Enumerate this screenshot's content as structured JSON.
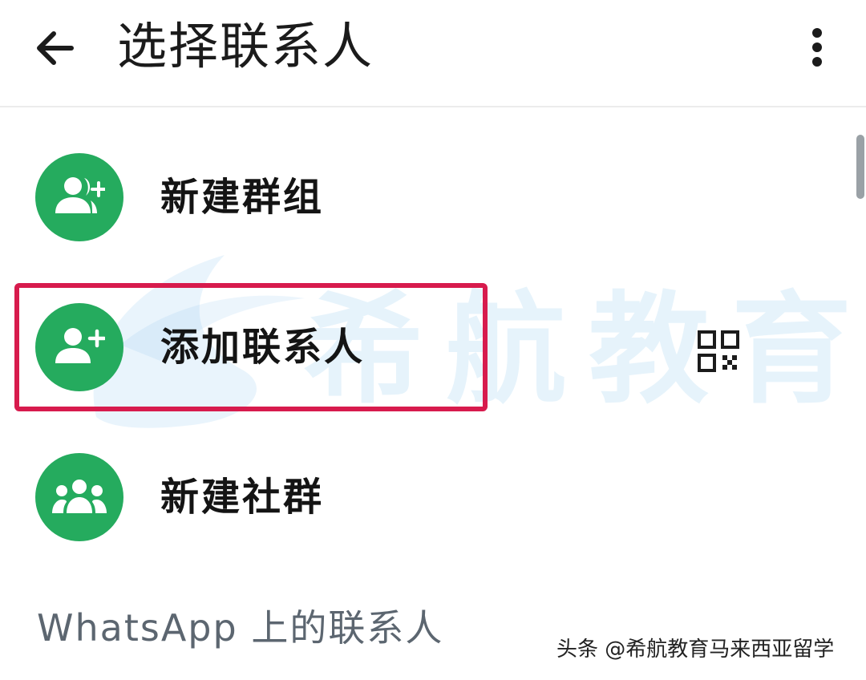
{
  "header": {
    "title": "选择联系人",
    "back_icon": "arrow-left-icon",
    "menu_icon": "more-vertical-icon"
  },
  "actions": [
    {
      "label": "新建群组",
      "icon": "group-add-icon"
    },
    {
      "label": "添加联系人",
      "icon": "person-add-icon",
      "trailing_icon": "qr-code-icon",
      "highlighted": true
    },
    {
      "label": "新建社群",
      "icon": "community-icon"
    }
  ],
  "section": {
    "title": "WhatsApp 上的联系人"
  },
  "watermark": {
    "text": "希航教育"
  },
  "credit": {
    "text": "头条 @希航教育马来西亚留学"
  },
  "colors": {
    "accent_green": "#25ab5e",
    "highlight_red": "#d71b4d",
    "watermark_blue": "#76baeb"
  }
}
